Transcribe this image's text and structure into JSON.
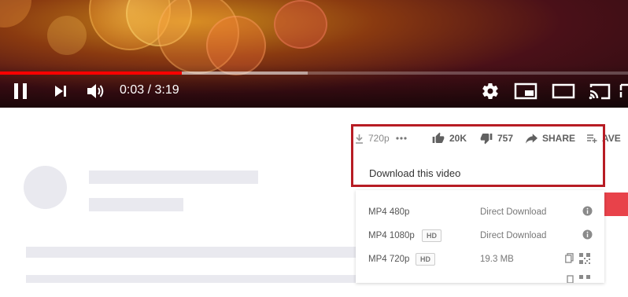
{
  "player": {
    "time_display": "0:03 / 3:19",
    "progress_played": 0.29,
    "progress_buffered": 0.49,
    "controls": {
      "play_pause_icon": "pause-icon",
      "next_icon": "skip-next-icon",
      "volume_icon": "volume-icon",
      "settings_icon": "gear-icon",
      "miniplayer_icon": "miniplayer-icon",
      "theater_icon": "theater-mode-icon",
      "cast_icon": "cast-icon"
    }
  },
  "video_actions": {
    "quality_label": "720p",
    "more_icon": "more-horizontal-icon",
    "likes": "20K",
    "dislikes": "757",
    "share_label": "SHARE",
    "save_label": "AVE"
  },
  "download": {
    "title": "Download this video",
    "options": [
      {
        "format": "MP4 480p",
        "badge": "",
        "action": "Direct Download",
        "icon": "info-icon"
      },
      {
        "format": "MP4 1080p",
        "badge": "HD",
        "action": "Direct Download",
        "icon": "info-icon"
      },
      {
        "format": "MP4 720p",
        "badge": "HD",
        "action": "19.3 MB",
        "icon": "copy-qr-icons"
      }
    ]
  },
  "colors": {
    "progress_red": "#ff0000",
    "highlight_border": "#b71c24",
    "placeholder_gray": "#e9e9ef"
  }
}
